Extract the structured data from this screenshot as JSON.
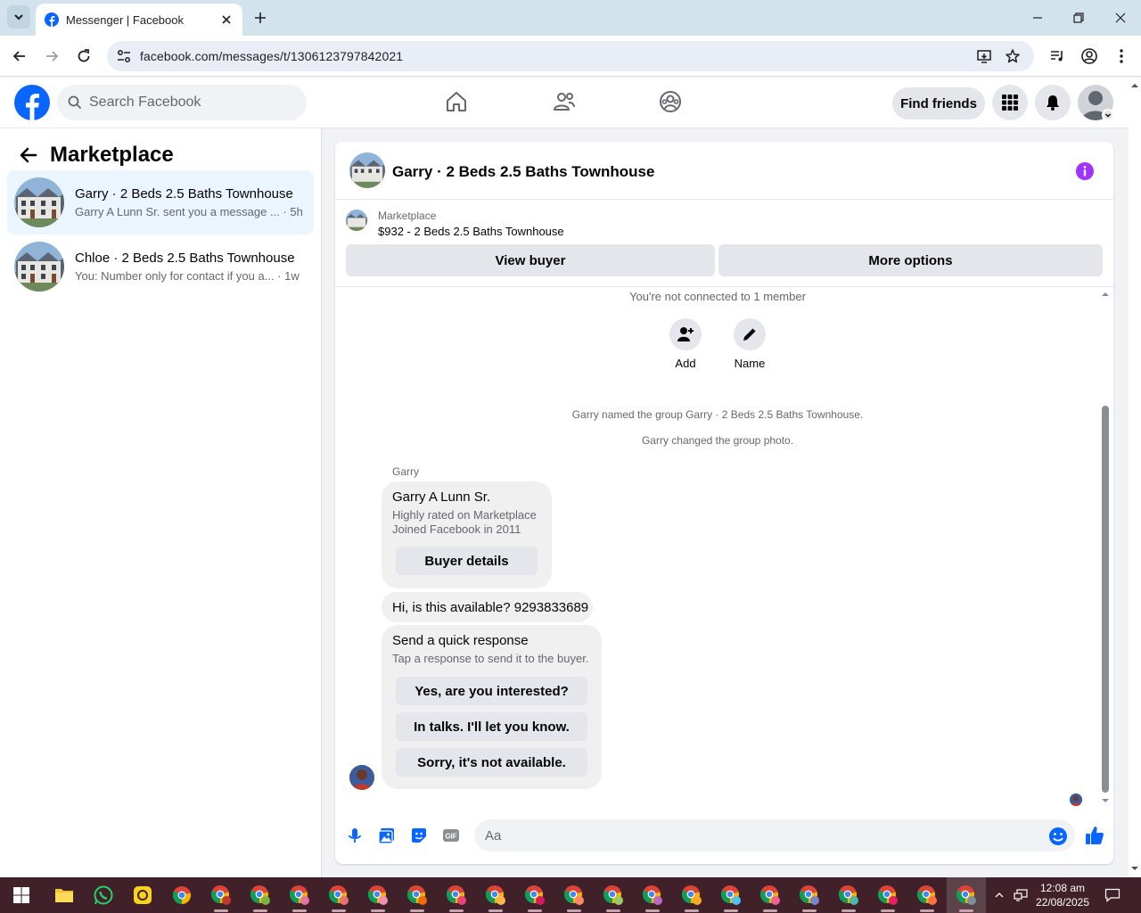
{
  "browser": {
    "tab_title": "Messenger | Facebook",
    "url": "facebook.com/messages/t/1306123797842021",
    "icons": [
      "tab-list-icon",
      "facebook-favicon",
      "close-tab-icon",
      "new-tab-icon",
      "minimize-icon",
      "restore-icon",
      "close-window-icon",
      "back-icon",
      "forward-icon",
      "reload-icon",
      "site-info-icon",
      "install-app-icon",
      "bookmark-star-icon",
      "media-controls-icon",
      "profile-icon",
      "menu-icon"
    ]
  },
  "facebook": {
    "search_placeholder": "Search Facebook",
    "find_friends": "Find friends",
    "brand_color": "#0866ff"
  },
  "sidebar": {
    "title": "Marketplace",
    "conversations": [
      {
        "name": "Garry · 2 Beds 2.5 Baths Townhouse",
        "preview": "Garry A Lunn Sr. sent you a message ...",
        "time": "· 5h",
        "active": true
      },
      {
        "name": "Chloe · 2 Beds 2.5 Baths Townhouse",
        "preview": "You: Number only for contact if you a...",
        "time": "· 1w",
        "active": false
      }
    ]
  },
  "chat": {
    "title": "Garry · 2 Beds 2.5 Baths Townhouse",
    "listing": {
      "source": "Marketplace",
      "price_title": "$932 - 2 Beds 2.5 Baths Townhouse"
    },
    "view_buyer": "View buyer",
    "more_options": "More options",
    "not_connected": "You're not connected to 1 member",
    "actions": {
      "add": "Add",
      "name": "Name"
    },
    "system_messages": [
      "Garry named the group Garry · 2 Beds 2.5 Baths Townhouse.",
      "Garry changed the group photo."
    ],
    "sender_label": "Garry",
    "buyer_card": {
      "name": "Garry A Lunn Sr.",
      "line1": "Highly rated on Marketplace",
      "line2": "Joined Facebook in 2011",
      "button": "Buyer details"
    },
    "message": "Hi, is this available? 9293833689",
    "quick_response": {
      "title": "Send a quick response",
      "subtitle": "Tap a response to send it to the buyer.",
      "options": [
        "Yes, are you interested?",
        "In talks. I'll let you know.",
        "Sorry, it's not available."
      ]
    },
    "composer_placeholder": "Aa",
    "accent_color": "#0866ff",
    "info_color": "#a033ff"
  },
  "taskbar": {
    "time": "12:08 am",
    "date": "22/08/2025"
  }
}
